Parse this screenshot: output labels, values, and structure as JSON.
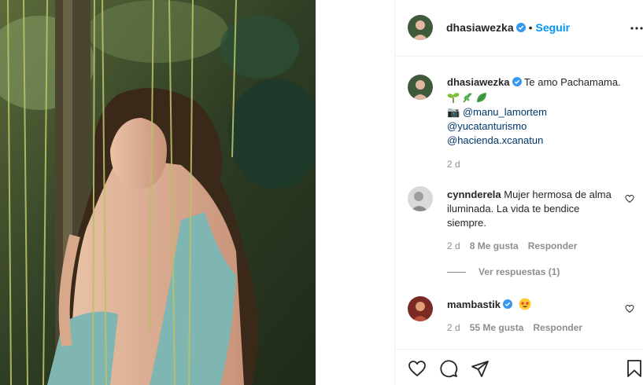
{
  "post": {
    "author": "dhasiawezka",
    "follow_label": "Seguir",
    "dot": "•",
    "photo_icon": "camera-icon"
  },
  "caption": {
    "author": "dhasiawezka",
    "text": "Te amo Pachamama.",
    "emojis": [
      "seedling-emoji",
      "herb-emoji",
      "leaf-emoji"
    ],
    "camera": "📷",
    "tags": [
      "@manu_lamortem",
      "@yucatanturismo",
      "@hacienda.xcanatun"
    ],
    "time": "2 d"
  },
  "comments": [
    {
      "author": "cynnderela",
      "text": "Mujer hermosa de alma iluminada. La vida te bendice siempre.",
      "time": "2 d",
      "likes": "8 Me gusta",
      "reply": "Responder",
      "view_replies": "Ver respuestas (1)"
    },
    {
      "author": "mambastik",
      "emoji": "star-struck-emoji",
      "time": "2 d",
      "likes": "55 Me gusta",
      "reply": "Responder"
    }
  ],
  "colors": {
    "accent": "#0095f6",
    "verified": "#3897f0",
    "link": "#00376b",
    "muted": "#8e8e8e"
  }
}
